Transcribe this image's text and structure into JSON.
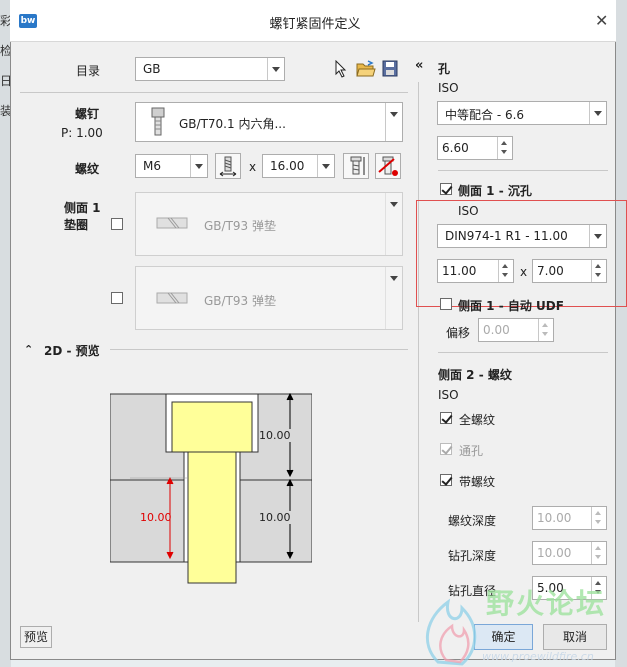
{
  "dialog_title": "螺钉紧固件定义",
  "bg_left_chars": [
    "彩",
    "检",
    "日",
    "装"
  ],
  "catalog": {
    "label": "目录",
    "value": "GB"
  },
  "screw": {
    "label": "螺钉",
    "p_label": "P: 1.00",
    "value": "GB/T70.1 内六角..."
  },
  "thread": {
    "label": "螺纹",
    "size": "M6",
    "times": "x",
    "length": "16.00"
  },
  "side1_washer": {
    "label_line1": "侧面 1",
    "label_line2": "垫圈",
    "item1": "GB/T93 弹垫",
    "item2": "GB/T93 弹垫"
  },
  "preview": {
    "section_label": "2D - 预览",
    "dim_top": "10.00",
    "dim_bottom": "10.00",
    "dim_left": "10.00",
    "colors": {
      "plate": "#d9d9d9",
      "screw": "#ffff99",
      "dim_red": "#e00000"
    }
  },
  "hole_panel": {
    "collapse": "«",
    "title": "孔",
    "standard": "ISO",
    "fit_value": "中等配合 - 6.6",
    "diameter": "6.60",
    "side1_counterbore": {
      "label": "侧面 1 - 沉孔",
      "checked": true,
      "standard": "ISO",
      "type_value": "DIN974-1 R1 - 11.00",
      "dia": "11.00",
      "times": "x",
      "depth": "7.00"
    },
    "side1_auto_udf": {
      "label": "侧面 1 - 自动 UDF",
      "checked": false
    },
    "offset": {
      "label": "偏移",
      "value": "0.00"
    },
    "side2_thread": {
      "label": "侧面 2 - 螺纹",
      "standard": "ISO"
    },
    "full_thread": {
      "label": "全螺纹",
      "checked": true
    },
    "through_hole": {
      "label": "通孔",
      "checked": true
    },
    "with_thread": {
      "label": "带螺纹",
      "checked": true
    },
    "thread_depth": {
      "label": "螺纹深度",
      "value": "10.00"
    },
    "drill_depth": {
      "label": "钻孔深度",
      "value": "10.00"
    },
    "drill_dia": {
      "label": "钻孔直径",
      "value": "5.00"
    }
  },
  "footer": {
    "preview_button": "预览",
    "ok_button": "确定",
    "cancel_button": "取消"
  },
  "watermark": {
    "title": "野火论坛",
    "url": "www.proewildfire.cn"
  },
  "highlight_color": "#e05050"
}
